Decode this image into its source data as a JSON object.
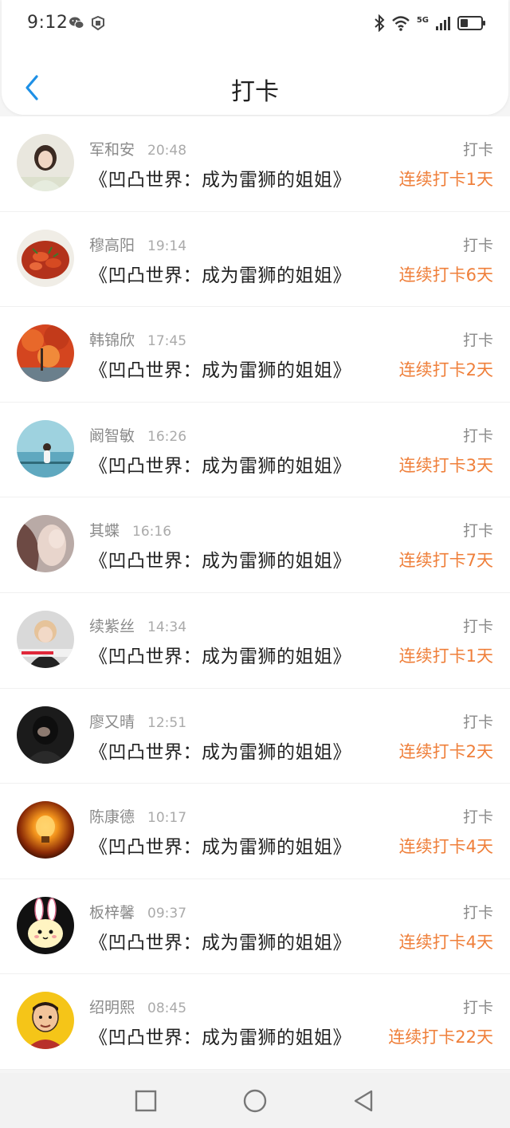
{
  "status_bar": {
    "time": "9:12",
    "network_label": "5G"
  },
  "nav": {
    "title": "打卡",
    "back_icon": "chevron-left-icon"
  },
  "colors": {
    "accent": "#ef7f3a",
    "back_arrow": "#1e90e6"
  },
  "entries": [
    {
      "name": "军和安",
      "time": "20:48",
      "book": "《凹凸世界：成为雷狮的姐姐》",
      "action": "打卡",
      "streak": "连续打卡1天"
    },
    {
      "name": "穆高阳",
      "time": "19:14",
      "book": "《凹凸世界：成为雷狮的姐姐》",
      "action": "打卡",
      "streak": "连续打卡6天"
    },
    {
      "name": "韩锦欣",
      "time": "17:45",
      "book": "《凹凸世界：成为雷狮的姐姐》",
      "action": "打卡",
      "streak": "连续打卡2天"
    },
    {
      "name": "阚智敏",
      "time": "16:26",
      "book": "《凹凸世界：成为雷狮的姐姐》",
      "action": "打卡",
      "streak": "连续打卡3天"
    },
    {
      "name": "其蝶",
      "time": "16:16",
      "book": "《凹凸世界：成为雷狮的姐姐》",
      "action": "打卡",
      "streak": "连续打卡7天"
    },
    {
      "name": "续紫丝",
      "time": "14:34",
      "book": "《凹凸世界：成为雷狮的姐姐》",
      "action": "打卡",
      "streak": "连续打卡1天"
    },
    {
      "name": "廖又晴",
      "time": "12:51",
      "book": "《凹凸世界：成为雷狮的姐姐》",
      "action": "打卡",
      "streak": "连续打卡2天"
    },
    {
      "name": "陈康德",
      "time": "10:17",
      "book": "《凹凸世界：成为雷狮的姐姐》",
      "action": "打卡",
      "streak": "连续打卡4天"
    },
    {
      "name": "板梓馨",
      "time": "09:37",
      "book": "《凹凸世界：成为雷狮的姐姐》",
      "action": "打卡",
      "streak": "连续打卡4天"
    },
    {
      "name": "绍明熙",
      "time": "08:45",
      "book": "《凹凸世界：成为雷狮的姐姐》",
      "action": "打卡",
      "streak": "连续打卡22天"
    }
  ],
  "bottom_nav": {
    "recents_icon": "square-icon",
    "home_icon": "circle-icon",
    "back_icon": "triangle-back-icon"
  }
}
